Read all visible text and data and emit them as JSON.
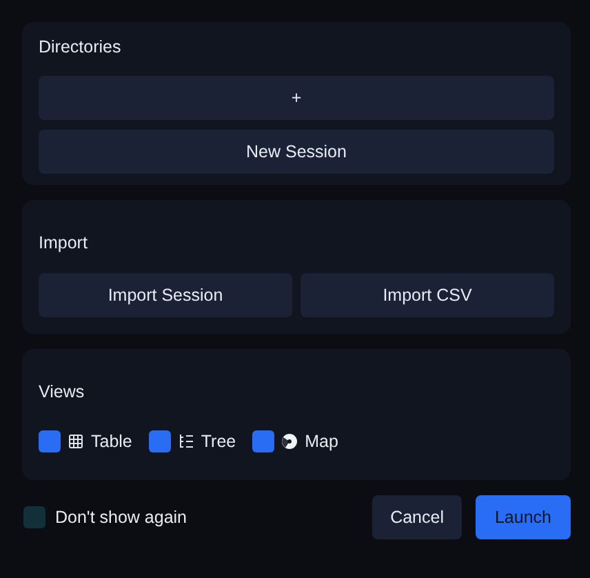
{
  "sections": [
    {
      "kind": "stack",
      "title": "Directories",
      "buttons": [
        "+",
        "New Session"
      ]
    },
    {
      "kind": "row",
      "title": "Import",
      "buttons": [
        "Import Session",
        "Import CSV"
      ]
    },
    {
      "kind": "views",
      "title": "Views",
      "views": [
        {
          "kind": "table",
          "label": "Table",
          "checked": true
        },
        {
          "kind": "tree",
          "label": "Tree",
          "checked": true
        },
        {
          "kind": "map",
          "label": "Map",
          "checked": true
        }
      ]
    }
  ],
  "footer": {
    "dont_show_again": {
      "label": "Don't show again",
      "checked": false
    },
    "buttons": [
      {
        "label": "Cancel",
        "kind": "secondary"
      },
      {
        "label": "Launch",
        "kind": "primary"
      }
    ]
  }
}
